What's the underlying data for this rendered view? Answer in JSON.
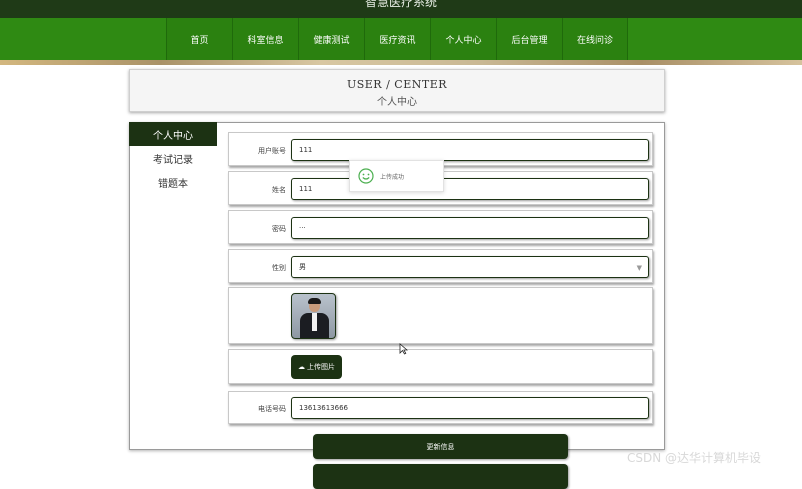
{
  "site": {
    "title": "智慧医疗系统"
  },
  "nav": [
    "首页",
    "科室信息",
    "健康测试",
    "医疗资讯",
    "个人中心",
    "后台管理",
    "在线问诊"
  ],
  "header": {
    "en": "USER / CENTER",
    "zh": "个人中心"
  },
  "sidebar": [
    {
      "label": "个人中心",
      "active": true
    },
    {
      "label": "考试记录",
      "active": false
    },
    {
      "label": "错题本",
      "active": false
    }
  ],
  "form": {
    "account": {
      "label": "用户账号",
      "value": "111"
    },
    "name": {
      "label": "姓名",
      "value": "111"
    },
    "password": {
      "label": "密码",
      "value": "···"
    },
    "gender": {
      "label": "性别",
      "value": "男"
    },
    "phone": {
      "label": "电话号码",
      "value": "13613613666"
    }
  },
  "upload": {
    "label": "上传图片"
  },
  "actions": {
    "update": "更新信息"
  },
  "toast": {
    "text": "上传成功"
  },
  "watermark": "CSDN @达华计算机毕设",
  "colors": {
    "nav_green": "#2f8a13",
    "dark_green": "#1c3213",
    "topbar": "#1f3a17"
  }
}
